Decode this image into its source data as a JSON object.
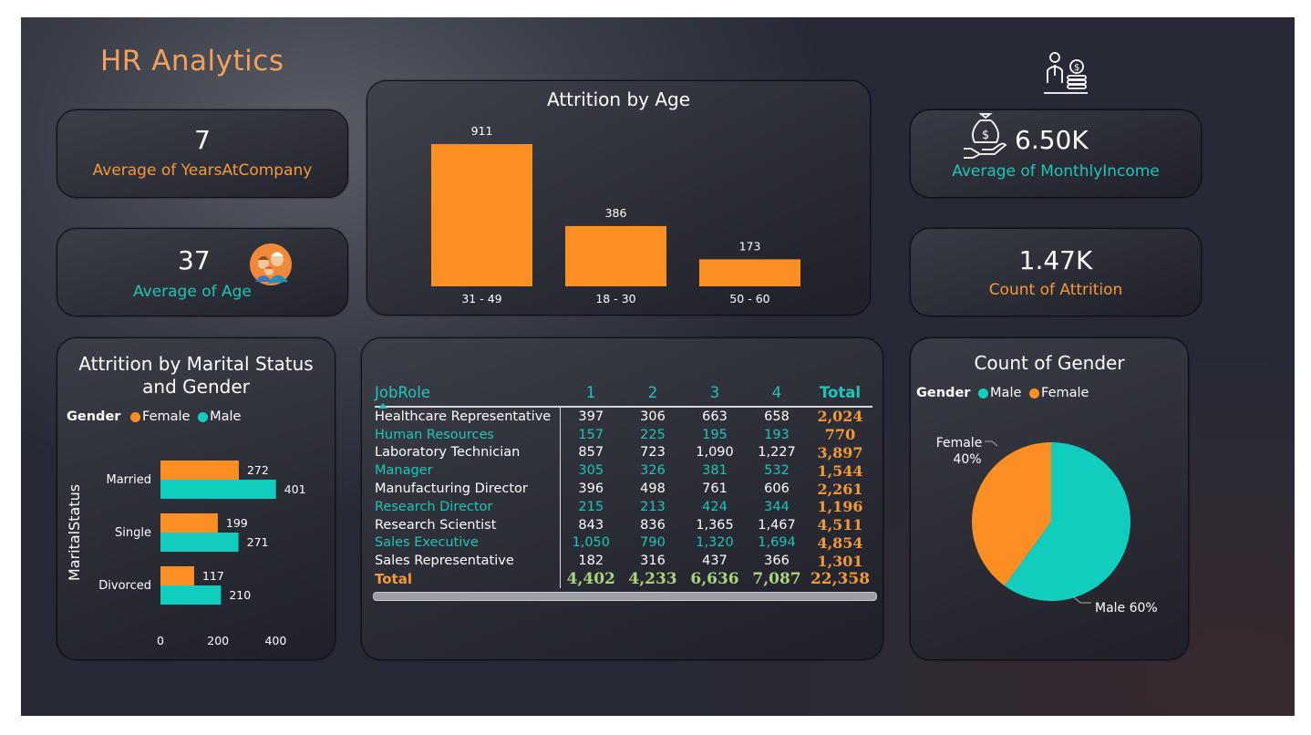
{
  "title": "HR Analytics",
  "colors": {
    "orange": "#f39a36",
    "teal": "#1cc6b8",
    "bar": "#fb8f24"
  },
  "kpis": {
    "years": {
      "value": "7",
      "label": "Average of YearsAtCompany"
    },
    "age": {
      "value": "37",
      "label": "Average of Age"
    },
    "income": {
      "value": "6.50K",
      "label": "Average of MonthlyIncome"
    },
    "attrition": {
      "value": "1.47K",
      "label": "Count of Attrition"
    }
  },
  "icons": {
    "people": "people-group-icon",
    "money_hand": "money-bag-hand-icon",
    "person_coins": "person-coins-icon"
  },
  "chart_data": [
    {
      "type": "bar",
      "title": "Attrition by Age",
      "categories": [
        "31 - 49",
        "18 - 30",
        "50 - 60"
      ],
      "values": [
        911,
        386,
        173
      ],
      "data_labels": [
        "911",
        "386",
        "173"
      ],
      "ylim": [
        0,
        911
      ],
      "grid": false
    },
    {
      "type": "bar",
      "orientation": "horizontal",
      "title": "Attrition by Marital Status and Gender",
      "ylabel": "MaritalStatus",
      "legend": {
        "title": "Gender",
        "position": "top-left"
      },
      "categories": [
        "Married",
        "Single",
        "Divorced"
      ],
      "series": [
        {
          "name": "Female",
          "values": [
            272,
            199,
            117
          ],
          "color": "#fb8f24"
        },
        {
          "name": "Male",
          "values": [
            401,
            271,
            210
          ],
          "color": "#10cdbd"
        }
      ],
      "xticks": [
        "0",
        "200",
        "400"
      ],
      "xlim": [
        0,
        400
      ],
      "grid": false
    },
    {
      "type": "pie",
      "title": "Count of Gender",
      "legend": {
        "title": "Gender",
        "position": "top-left"
      },
      "series": [
        {
          "name": "Male",
          "value": 60,
          "color": "#10cdbd",
          "label": "Male 60%"
        },
        {
          "name": "Female",
          "value": 40,
          "color": "#fb8f24",
          "label_line1": "Female",
          "label_line2": "40%"
        }
      ]
    },
    {
      "type": "table",
      "columns": [
        "JobRole",
        "1",
        "2",
        "3",
        "4",
        "Total"
      ],
      "rows": [
        [
          "Healthcare Representative",
          "397",
          "306",
          "663",
          "658",
          "2,024"
        ],
        [
          "Human Resources",
          "157",
          "225",
          "195",
          "193",
          "770"
        ],
        [
          "Laboratory Technician",
          "857",
          "723",
          "1,090",
          "1,227",
          "3,897"
        ],
        [
          "Manager",
          "305",
          "326",
          "381",
          "532",
          "1,544"
        ],
        [
          "Manufacturing Director",
          "396",
          "498",
          "761",
          "606",
          "2,261"
        ],
        [
          "Research Director",
          "215",
          "213",
          "424",
          "344",
          "1,196"
        ],
        [
          "Research Scientist",
          "843",
          "836",
          "1,365",
          "1,467",
          "4,511"
        ],
        [
          "Sales Executive",
          "1,050",
          "790",
          "1,320",
          "1,694",
          "4,854"
        ],
        [
          "Sales Representative",
          "182",
          "316",
          "437",
          "366",
          "1,301"
        ]
      ],
      "total_row": [
        "Total",
        "4,402",
        "4,233",
        "6,636",
        "7,087",
        "22,358"
      ]
    }
  ]
}
